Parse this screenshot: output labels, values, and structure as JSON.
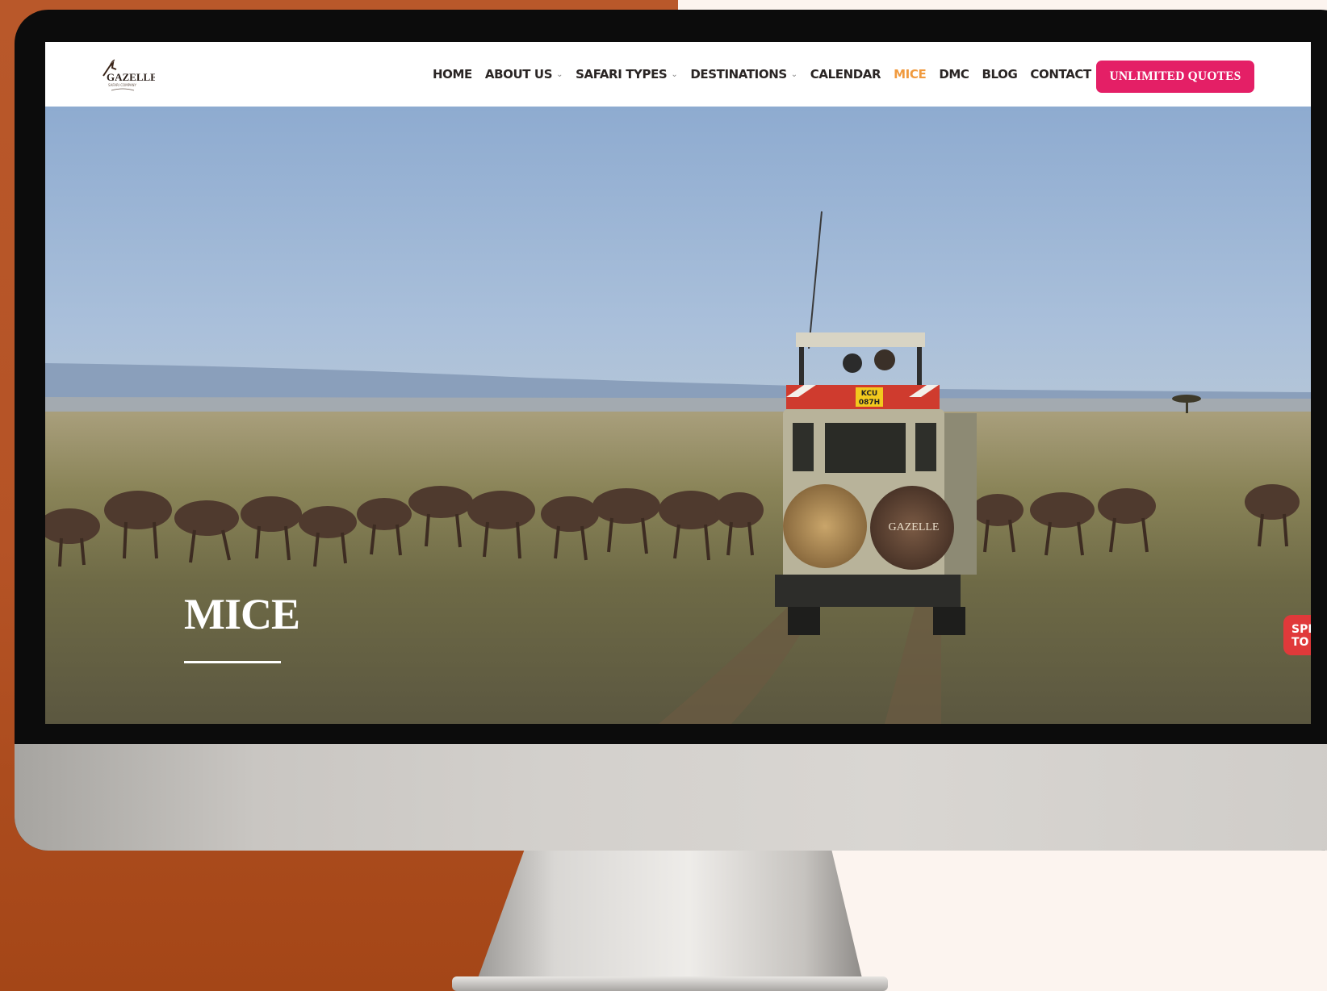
{
  "brand": {
    "logo_text": "GAZELLE",
    "logo_subtext": "SAFARI COMPANY"
  },
  "nav": {
    "items": [
      {
        "label": "HOME",
        "has_dropdown": false,
        "active": false
      },
      {
        "label": "ABOUT US",
        "has_dropdown": true,
        "active": false
      },
      {
        "label": "SAFARI TYPES",
        "has_dropdown": true,
        "active": false
      },
      {
        "label": "DESTINATIONS",
        "has_dropdown": true,
        "active": false
      },
      {
        "label": "CALENDAR",
        "has_dropdown": false,
        "active": false
      },
      {
        "label": "MICE",
        "has_dropdown": false,
        "active": true
      },
      {
        "label": "DMC",
        "has_dropdown": false,
        "active": false
      },
      {
        "label": "BLOG",
        "has_dropdown": false,
        "active": false
      },
      {
        "label": "CONTACT US",
        "has_dropdown": false,
        "active": false
      }
    ],
    "cta_label": "UNLIMITED QUOTES",
    "active_color": "#f09a3e",
    "cta_color": "#e41f66"
  },
  "hero": {
    "title": "MICE",
    "vehicle_plate_line1": "KCU",
    "vehicle_plate_line2": "087H",
    "spare_tire_brand": "GAZELLE"
  },
  "widget": {
    "line1": "SPEA",
    "line2": "TO U"
  },
  "colors": {
    "background_left": "#b55326",
    "background_right": "#fcf4ef"
  }
}
